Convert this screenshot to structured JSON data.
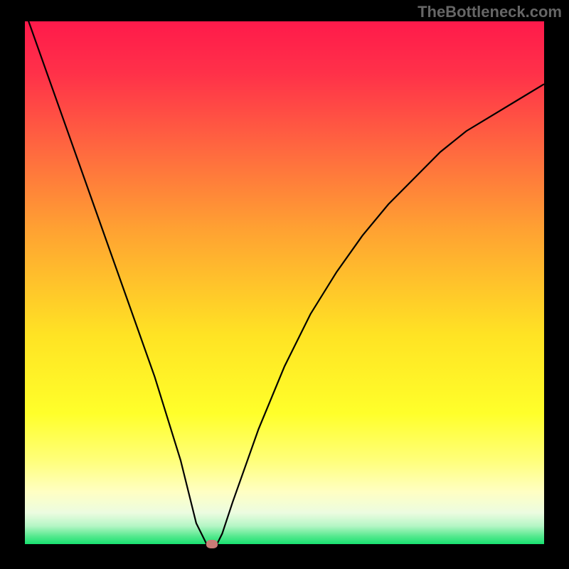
{
  "watermark": "TheBottleneck.com",
  "chart_data": {
    "type": "line",
    "title": "",
    "xlabel": "",
    "ylabel": "",
    "xlim": [
      0,
      100
    ],
    "ylim": [
      0,
      100
    ],
    "grid": false,
    "legend_position": "none",
    "series": [
      {
        "name": "bottleneck-curve",
        "x": [
          0,
          5,
          10,
          15,
          20,
          25,
          30,
          33,
          35,
          36,
          37,
          38,
          40,
          45,
          50,
          55,
          60,
          65,
          70,
          75,
          80,
          85,
          90,
          95,
          100
        ],
        "y": [
          102,
          88,
          74,
          60,
          46,
          32,
          16,
          4,
          0,
          0,
          0,
          2,
          8,
          22,
          34,
          44,
          52,
          59,
          65,
          70,
          75,
          79,
          82,
          85,
          88
        ]
      }
    ],
    "marker": {
      "x": 36,
      "y": 0,
      "color": "#c97b76"
    },
    "background_gradient_stops": [
      {
        "offset": 0.0,
        "color": "#ff1a4b"
      },
      {
        "offset": 0.1,
        "color": "#ff3149"
      },
      {
        "offset": 0.25,
        "color": "#ff6a3f"
      },
      {
        "offset": 0.4,
        "color": "#ffa232"
      },
      {
        "offset": 0.6,
        "color": "#ffe324"
      },
      {
        "offset": 0.75,
        "color": "#ffff2a"
      },
      {
        "offset": 0.84,
        "color": "#ffff7a"
      },
      {
        "offset": 0.9,
        "color": "#ffffc3"
      },
      {
        "offset": 0.94,
        "color": "#ecfce0"
      },
      {
        "offset": 0.965,
        "color": "#b6f6c6"
      },
      {
        "offset": 0.985,
        "color": "#55e98e"
      },
      {
        "offset": 1.0,
        "color": "#18e170"
      }
    ]
  }
}
